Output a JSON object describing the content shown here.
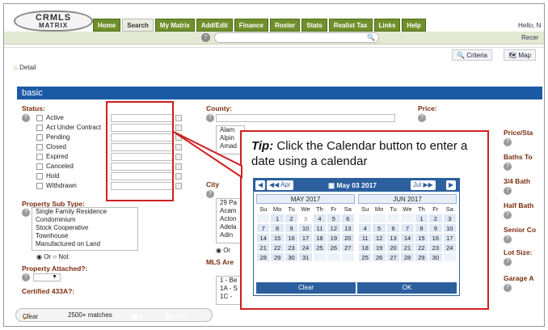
{
  "header": {
    "logo_line1": "CRMLS",
    "logo_line2": "MATRIX",
    "nav": [
      "Home",
      "Search",
      "My Matrix",
      "Add/Edit",
      "Finance",
      "Roster",
      "Stats",
      "Realist Tax",
      "Links",
      "Help"
    ],
    "active_nav": "Search",
    "greeting": "Hello, N",
    "recent": "Recer",
    "help_icon": "?"
  },
  "toolbar": {
    "criteria": "Criteria",
    "map": "Map"
  },
  "breadcrumb": {
    "detail": "Detail"
  },
  "section": {
    "title": "basic"
  },
  "status": {
    "label": "Status:",
    "options": [
      "Active",
      "Act Under Contract",
      "Pending",
      "Closed",
      "Expired",
      "Canceled",
      "Hold",
      "Withdrawn"
    ]
  },
  "county": {
    "label": "County:",
    "visible_items": [
      "Alam",
      "Alpin",
      "Amad"
    ]
  },
  "city": {
    "label": "City",
    "visible_items": [
      "29 Pa",
      "Acam",
      "Acton",
      "Adela",
      "Adin"
    ],
    "or_label": "Or"
  },
  "mls_area": {
    "label": "MLS Are",
    "visible_items": [
      "1 - Be",
      "1A - S",
      "1C -"
    ]
  },
  "price": {
    "label": "Price:"
  },
  "right_col": {
    "labels": [
      "Price/Sta",
      "Baths To",
      "3/4 Bath",
      "Half Bath",
      "Senior Co",
      "Lot Size:",
      "Garage A"
    ]
  },
  "property_sub_type": {
    "label": "Property Sub Type:",
    "items": [
      "Single Family Residence",
      "Condominium",
      "Stock Cooperative",
      "Townhouse",
      "Manufactured on Land"
    ],
    "or_label": "Or",
    "not_label": "Not"
  },
  "property_attached": {
    "label": "Property Attached?:"
  },
  "certified": {
    "label": "Certified 433A?:"
  },
  "callout": {
    "tip_label": "Tip:",
    "tip_text": "Click the Calendar button to enter a date using a calendar"
  },
  "calendar": {
    "prev_month": "Apr",
    "next_month": "Jul",
    "today_label": "May 03 2017",
    "months": [
      {
        "title": "MAY 2017",
        "days": [
          "",
          "1",
          "2",
          "3",
          "4",
          "5",
          "6",
          "7",
          "8",
          "9",
          "10",
          "11",
          "12",
          "13",
          "14",
          "15",
          "16",
          "17",
          "18",
          "19",
          "20",
          "21",
          "22",
          "23",
          "24",
          "25",
          "26",
          "27",
          "28",
          "29",
          "30",
          "31",
          "",
          "",
          ""
        ],
        "today_index": 3
      },
      {
        "title": "JUN 2017",
        "days": [
          "",
          "",
          "",
          "",
          "1",
          "2",
          "3",
          "4",
          "5",
          "6",
          "7",
          "8",
          "9",
          "10",
          "11",
          "12",
          "13",
          "14",
          "15",
          "16",
          "17",
          "18",
          "19",
          "20",
          "21",
          "22",
          "23",
          "24",
          "25",
          "26",
          "27",
          "28",
          "29",
          "30",
          ""
        ],
        "today_index": -1
      }
    ],
    "dow": [
      "Su",
      "Mo",
      "Tu",
      "We",
      "Th",
      "Fr",
      "Sa"
    ],
    "clear_label": "Clear",
    "ok_label": "OK"
  },
  "bottom": {
    "clear": "Clear",
    "matches": "2500+ matches",
    "map": "Map",
    "results": "Results"
  }
}
